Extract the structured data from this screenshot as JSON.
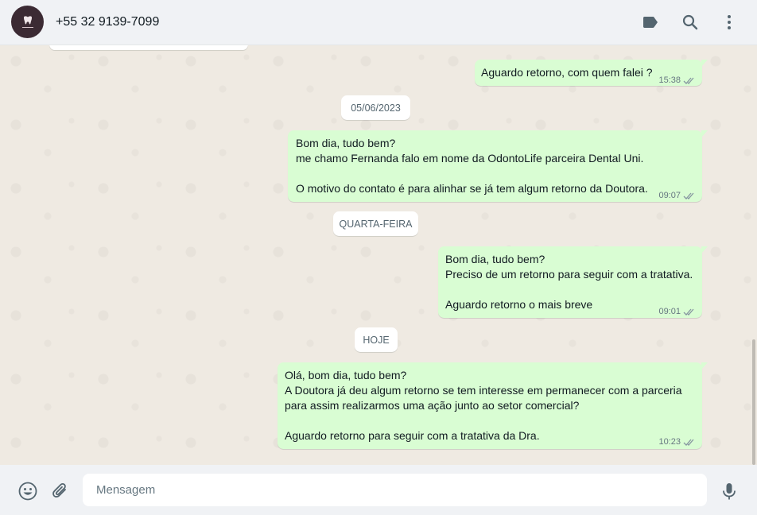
{
  "header": {
    "contact_name": "+55 32 9139-7099",
    "icons": [
      "label-icon",
      "search-icon",
      "menu-icon"
    ]
  },
  "chat": {
    "messages": [
      {
        "lines": [
          "Aguardo retorno, com quem falei ?"
        ],
        "time": "15:38",
        "status": "delivered"
      },
      {
        "lines": [
          "Bom dia, tudo bem?",
          "me chamo Fernanda falo em nome da OdontoLife parceira Dental Uni.",
          "",
          "O motivo do contato é para alinhar se já tem algum retorno da Doutora."
        ],
        "time": "09:07",
        "status": "delivered"
      },
      {
        "lines": [
          "Bom dia, tudo bem?",
          "Preciso de um retorno para seguir com a tratativa.",
          "",
          "Aguardo retorno o mais breve"
        ],
        "time": "09:01",
        "status": "delivered"
      },
      {
        "lines": [
          "Olá, bom dia, tudo bem?",
          "A Doutora já deu algum retorno se tem interesse em permanecer com a parceria",
          "para assim realizarmos uma ação junto ao setor comercial?",
          "",
          "Aguardo retorno para seguir com a tratativa da Dra."
        ],
        "time": "10:23",
        "status": "delivered"
      }
    ],
    "date_separators": [
      "05/06/2023",
      "QUARTA-FEIRA",
      "HOJE"
    ]
  },
  "footer": {
    "input_placeholder": "Mensagem",
    "icons": [
      "emoji-icon",
      "attach-icon",
      "microphone-icon"
    ]
  },
  "colors": {
    "header_bg": "#f0f2f5",
    "chat_bg": "#efeae2",
    "outgoing_bubble": "#d9fdd3",
    "icon": "#54656f",
    "meta_text": "#667781"
  }
}
